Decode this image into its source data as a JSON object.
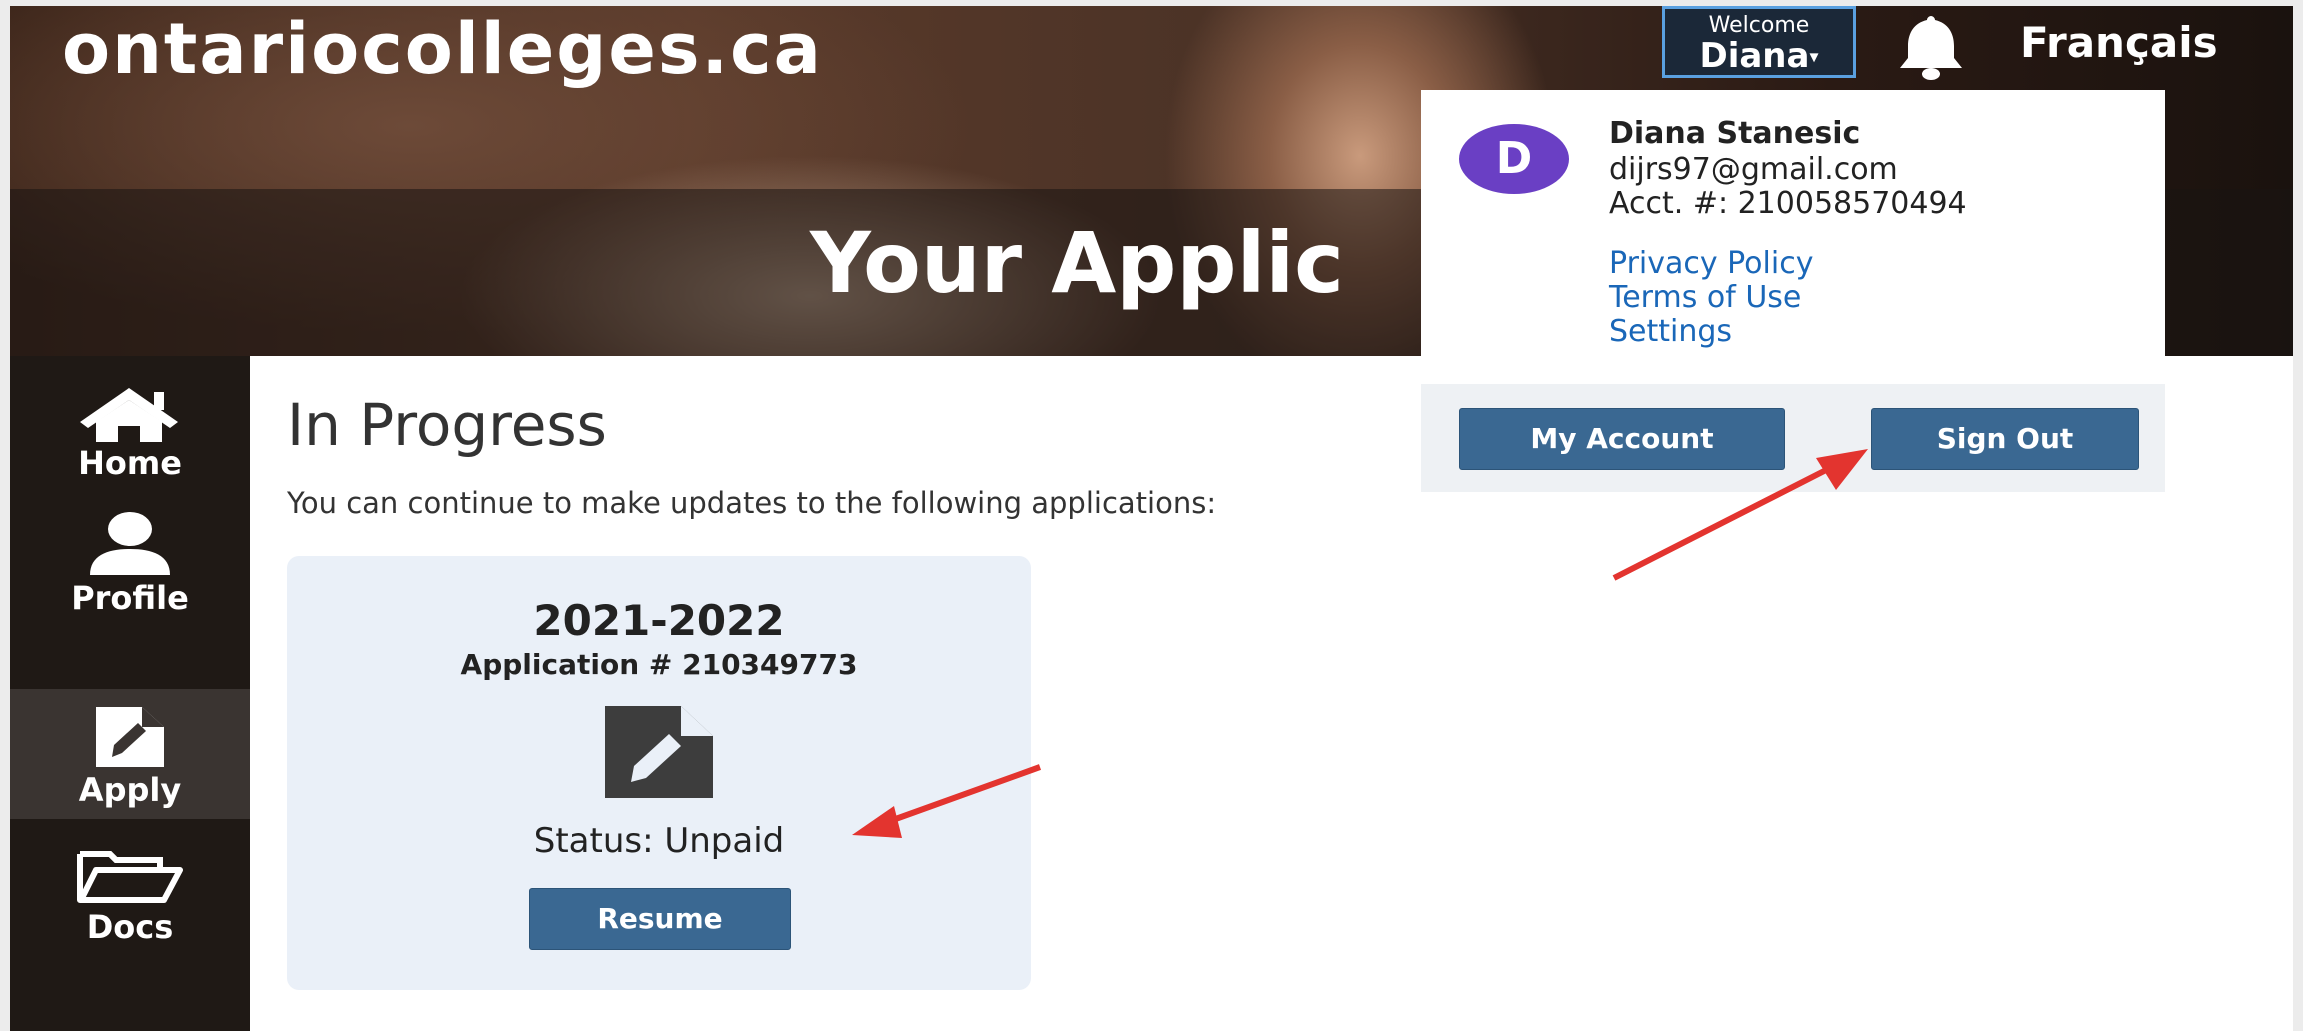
{
  "header": {
    "logo": "ontariocolleges.ca",
    "page_title": "Your Applic",
    "welcome_label": "Welcome",
    "user_first_name": "Diana",
    "language_link": "Français"
  },
  "account_menu": {
    "avatar_letter": "D",
    "full_name": "Diana Stanesic",
    "email": "dijrs97@gmail.com",
    "account_number": "Acct. #: 210058570494",
    "links": [
      "Privacy Policy",
      "Terms of Use",
      "Settings"
    ],
    "my_account_button": "My Account",
    "sign_out_button": "Sign Out"
  },
  "sidebar": {
    "items": [
      {
        "label": "Home",
        "icon": "home-icon"
      },
      {
        "label": "Profile",
        "icon": "user-icon"
      },
      {
        "label": "Apply",
        "icon": "document-edit-icon",
        "active": true
      },
      {
        "label": "Docs",
        "icon": "folder-icon"
      }
    ]
  },
  "main": {
    "section_title": "In Progress",
    "section_description": "You can continue to make updates to the following applications:",
    "application_card": {
      "year": "2021-2022",
      "application_number": "Application # 210349773",
      "icon": "document-edit-icon",
      "status": "Status: Unpaid",
      "resume_button": "Resume"
    }
  },
  "colors": {
    "sidebar_bg": "#1f1915",
    "button_blue": "#3a6892",
    "link_blue": "#1a67b8",
    "avatar_purple": "#6a3fc4",
    "card_bg": "#eaf0f8",
    "annotation_arrow": "#e3342f"
  }
}
